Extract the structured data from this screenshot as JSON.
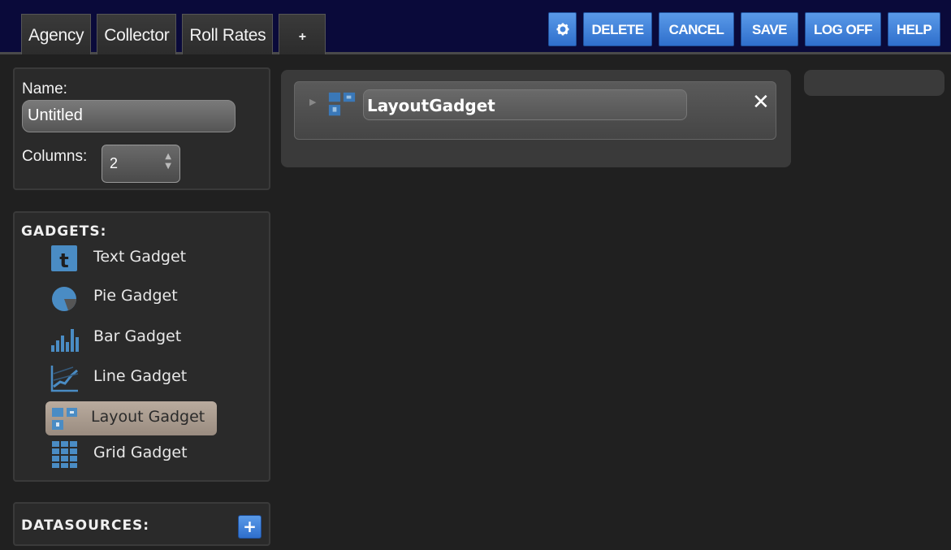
{
  "tabs": [
    {
      "label": "Agency"
    },
    {
      "label": "Collector"
    },
    {
      "label": "Roll Rates"
    },
    {
      "label": "+"
    }
  ],
  "actions": {
    "gear_icon": "gear-icon",
    "delete": "DELETE",
    "cancel": "CANCEL",
    "save": "SAVE",
    "logoff": "LOG OFF",
    "help": "HELP"
  },
  "settings": {
    "name_label": "Name:",
    "name_value": "Untitled",
    "columns_label": "Columns:",
    "columns_value": "2"
  },
  "gadgets": {
    "title": "GADGETS:",
    "items": [
      {
        "label": "Text Gadget",
        "icon": "text-gadget-icon"
      },
      {
        "label": "Pie Gadget",
        "icon": "pie-gadget-icon"
      },
      {
        "label": "Bar Gadget",
        "icon": "bar-gadget-icon"
      },
      {
        "label": "Line Gadget",
        "icon": "line-gadget-icon"
      },
      {
        "label": "Layout Gadget",
        "icon": "layout-gadget-icon",
        "selected": true
      },
      {
        "label": "Grid Gadget",
        "icon": "grid-gadget-icon"
      }
    ]
  },
  "datasources": {
    "title": "DATASOURCES:",
    "add_label": "+"
  },
  "canvas": {
    "card_title": "LayoutGadget",
    "close_label": "✕"
  },
  "colors": {
    "accent_blue": "#3a7fd8",
    "icon_blue": "#4a8cc4",
    "selected_bg": "#b0a296",
    "topbar_bg": "#0a0a3a"
  }
}
